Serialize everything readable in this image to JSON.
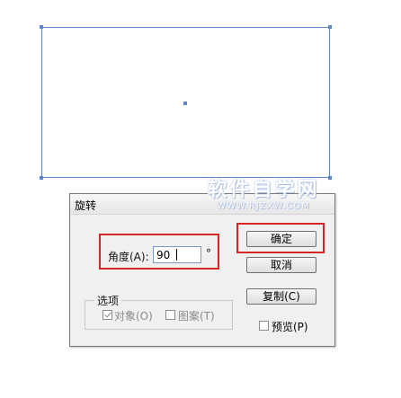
{
  "dialog": {
    "title": "旋转",
    "watermark": {
      "main": "软件自学网",
      "sub": "WWW.RJZXW.COM"
    },
    "angle": {
      "label": "角度(A):",
      "value": "90",
      "unit": "°"
    },
    "options": {
      "legend": "选项",
      "objects": {
        "label": "对象(O)",
        "checked": true,
        "enabled": false
      },
      "patterns": {
        "label": "图案(T)",
        "checked": false,
        "enabled": false
      }
    },
    "buttons": {
      "ok": "确定",
      "cancel": "取消",
      "copy": "复制(C)"
    },
    "preview": {
      "label": "预览(P)",
      "checked": false
    }
  },
  "colors": {
    "selection": "#5b86c8",
    "highlight": "#d62525"
  }
}
